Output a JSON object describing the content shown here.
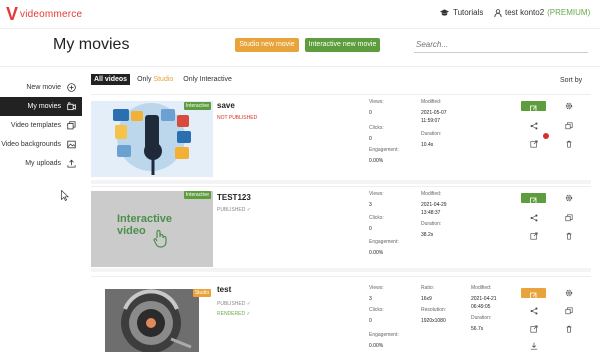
{
  "app": {
    "logo_text": "videommerce"
  },
  "topbar": {
    "tutorials": "Tutorials",
    "account_name": "test konto2",
    "account_plan": "(PREMIUM)"
  },
  "header": {
    "title": "My movies",
    "studio_new_movie": "Studio new movie",
    "interactive_new_movie": "Interactive new movie",
    "search_placeholder": "Search..."
  },
  "sidebar": {
    "items": [
      {
        "label": "New movie",
        "icon": "plus-circle-icon"
      },
      {
        "label": "My movies",
        "icon": "movie-icon"
      },
      {
        "label": "Video templates",
        "icon": "templates-icon"
      },
      {
        "label": "Video backgrounds",
        "icon": "image-icon"
      },
      {
        "label": "My uploads",
        "icon": "upload-icon"
      }
    ]
  },
  "filters": {
    "all": "All videos",
    "only": "Only",
    "studio": "Studio",
    "only_interactive": "Only Interactive",
    "sort_by": "Sort by"
  },
  "movies": [
    {
      "badge": "interactive",
      "title": "save",
      "status": "NOT PUBLISHED",
      "views_label": "Views:",
      "views": "0",
      "clicks_label": "Clicks:",
      "clicks": "0",
      "engagement_label": "Engagement:",
      "engagement": "0.00%",
      "modified_label": "Modified:",
      "modified_date": "2021-05-07",
      "modified_time": "11:59:07",
      "duration_label": "Duration:",
      "duration": "10.4s"
    },
    {
      "badge": "interactive",
      "title": "TEST123",
      "status": "PUBLISHED ✓",
      "thumb_text_1": "Interactive",
      "thumb_text_2": "video",
      "views_label": "Views:",
      "views": "3",
      "clicks_label": "Clicks:",
      "clicks": "0",
      "engagement_label": "Engagement:",
      "engagement": "0.00%",
      "modified_label": "Modified:",
      "modified_date": "2021-04-29",
      "modified_time": "13:48:37",
      "duration_label": "Duration:",
      "duration": "38.2s"
    },
    {
      "badge": "studio",
      "title": "test",
      "status": "PUBLISHED ✓",
      "status2": "RENDERED ✓",
      "views_label": "Views:",
      "views": "3",
      "clicks_label": "Clicks:",
      "clicks": "0",
      "engagement_label": "Engagement:",
      "engagement": "0.00%",
      "ratio_label": "Ratio:",
      "ratio": "16x9",
      "resolution_label": "Resolution:",
      "resolution": "1920x1080",
      "modified_label": "Modified:",
      "modified_date": "2021-04-21",
      "modified_time": "06:49:05",
      "duration_label": "Duration:",
      "duration": "56.7s"
    }
  ],
  "badges": {
    "interactive": "Interactive",
    "studio": "Studio"
  },
  "colors": {
    "brand_red": "#e53935",
    "green": "#5e9d3d",
    "orange": "#e8a33a",
    "dark": "#222222"
  }
}
